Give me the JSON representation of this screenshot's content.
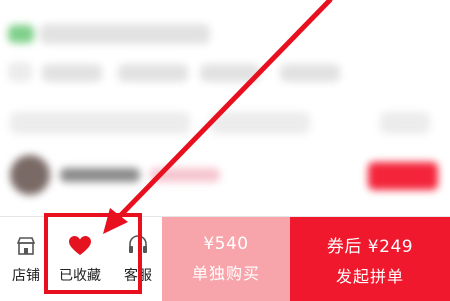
{
  "bottom_bar": {
    "store": {
      "label": "店铺",
      "icon": "store-icon"
    },
    "favorite": {
      "label": "已收藏",
      "icon": "heart-icon",
      "active": true
    },
    "service": {
      "label": "客服",
      "icon": "customer-service-icon"
    },
    "buy_single": {
      "price": "¥540",
      "label": "单独购买"
    },
    "buy_group": {
      "price": "券后 ¥249",
      "label": "发起拼单"
    }
  },
  "colors": {
    "single_button": "#f7a4ab",
    "group_button": "#f0182c",
    "annotation": "#e8101f",
    "heart": "#e5121f"
  }
}
